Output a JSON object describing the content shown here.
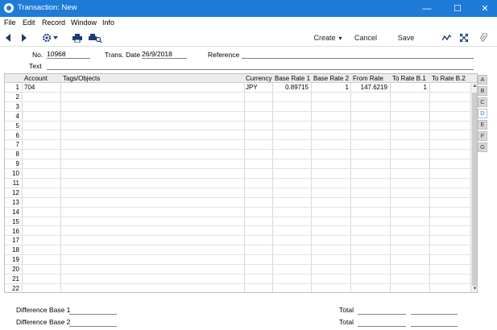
{
  "window": {
    "title": "Transaction: New",
    "minimize_glyph": "—",
    "maximize_glyph": "☐",
    "close_glyph": "✕"
  },
  "menu": [
    "File",
    "Edit",
    "Record",
    "Window",
    "Info"
  ],
  "toolbar": {
    "create_label": "Create",
    "create_arrow": "▾",
    "cancel_label": "Cancel",
    "save_label": "Save",
    "icons": [
      "back-arrow-icon",
      "forward-arrow-icon",
      "gear-icon",
      "print-icon",
      "print-preview-icon",
      "chart-icon",
      "expand-icon",
      "attachment-icon"
    ]
  },
  "header": {
    "no_label": "No.",
    "no_value": "10968",
    "trans_date_label": "Trans. Date",
    "trans_date_value": "26/9/2018",
    "reference_label": "Reference",
    "reference_value": "",
    "text_label": "Text",
    "text_value": ""
  },
  "grid": {
    "columns": [
      "Account",
      "Tags/Objects",
      "Currency",
      "Base Rate 1",
      "Base Rate 2",
      "From Rate",
      "To Rate B.1",
      "To Rate B.2"
    ],
    "row_numbers": [
      "1",
      "2",
      "3",
      "4",
      "5",
      "6",
      "7",
      "8",
      "9",
      "10",
      "11",
      "12",
      "13",
      "14",
      "15",
      "16",
      "17",
      "18",
      "19",
      "20",
      "21",
      "22"
    ],
    "rows": [
      {
        "account": "704",
        "tags": "",
        "currency": "JPY",
        "base_rate_1": "0.89715",
        "base_rate_2": "1",
        "from_rate": "147.6219",
        "to_rate_b1": "1",
        "to_rate_b2": ""
      }
    ]
  },
  "tabs": [
    "A",
    "B",
    "C",
    "D",
    "E",
    "F",
    "G"
  ],
  "active_tab": "D",
  "footer": {
    "diff_base_1_label": "Difference Base 1",
    "diff_base_2_label": "Difference Base 2",
    "total_label_1": "Total",
    "total_label_2": "Total"
  },
  "colors": {
    "titlebar": "#1e7bd8",
    "active_tab_text": "#1e6bc9"
  }
}
